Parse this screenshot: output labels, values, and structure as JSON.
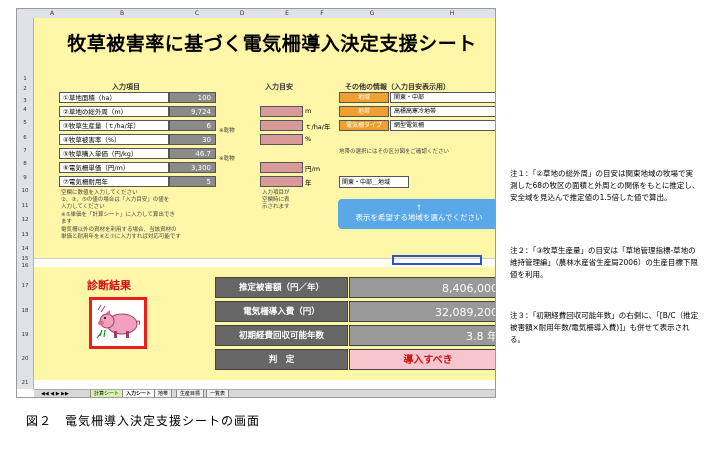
{
  "title": "牧草被害率に基づく電気柵導入決定支援シート",
  "col_headers": [
    "A",
    "B",
    "C",
    "D",
    "E",
    "F",
    "G",
    "H"
  ],
  "row_headers": [
    "1",
    "2",
    "3",
    "4",
    "5",
    "6",
    "7",
    "8",
    "9",
    "10",
    "11",
    "12",
    "13",
    "14",
    "15",
    "16",
    "17",
    "18",
    "19",
    "20",
    "21"
  ],
  "section_input": "入力項目",
  "section_guide": "入力目安",
  "section_other": "その他の情報（入力目安表示用）",
  "inputs": [
    {
      "label": "①草地面積（ha）",
      "value": "100"
    },
    {
      "label": "②草地の総外周（m）",
      "value": "9,724"
    },
    {
      "label": "③牧草生産量（ｔ/ha/年）",
      "value": "6"
    },
    {
      "label": "④牧草被害率（%）",
      "value": "30"
    },
    {
      "label": "⑤牧草購入単価（円/kg）",
      "value": "46.7"
    },
    {
      "label": "⑥電気柵単価（円/m）",
      "value": "3,300"
    },
    {
      "label": "⑦電気柵耐用年",
      "value": "5"
    }
  ],
  "dry_note_1": "※乾物",
  "dry_note_2": "※乾物",
  "units": [
    "m",
    "ｔ/ha/年",
    "%",
    "円/m",
    "年"
  ],
  "other": [
    {
      "label": "地域",
      "value": "関東・中部"
    },
    {
      "label": "地帯",
      "value": "高標高寒冷地帯"
    },
    {
      "label": "電気柵タイプ",
      "value": "網型電気柵"
    }
  ],
  "region_note": "地帯の選択にはその区分図をご確認ください",
  "region_value": "関東・中部＿地域",
  "left_notes": [
    "空欄に数値を入力してください",
    "②、③、⑤の値の場合は「入力目安」の値を",
    "入力してください",
    "※⑤単価を「計算シート」に入力して算出でき",
    "ます",
    "電気柵以外の資材を利用する場合、当該資材の",
    "単価と耐用年を⑥と⑦に入力すれば対応可能です"
  ],
  "guide_notes": [
    "入力項目が",
    "空欄時に表",
    "示されます"
  ],
  "button_arrow": "↑",
  "button_label": "表示を希望する地域を選んでください",
  "diag_title": "診断結果",
  "results": [
    {
      "label": "推定被害額（円／年）",
      "value": "8,406,000"
    },
    {
      "label": "電気柵導入費（円）",
      "value": "32,089,200"
    },
    {
      "label": "初期経費回収可能年数",
      "value": "3.8 年"
    },
    {
      "label": "判　定",
      "value": "導入すべき"
    }
  ],
  "tabs": [
    "計算シート",
    "入力シート",
    "地帯",
    "生産目標",
    "一覧表"
  ],
  "caption": "図２　電気柵導入決定支援シートの画面",
  "side_notes": [
    "注１：「②草地の総外周」の目安は関東地域の牧場で実測した68の牧区の面積と外周との関係をもとに推定し、安全域を見込んで推定値の1.5倍した値で算出。",
    "注２：「③牧草生産量」の目安は「草地管理指標-草地の維持管理編」（農林水産省生産局2006）の生産目標下限値を利用。",
    "注３：「初期経費回収可能年数」の右側に、「[B/C（推定被害額×耐用年数/電気柵導入費)]」も併せて表示される。"
  ],
  "colors": {
    "sheet_bg": "#fff6a8",
    "value_cell": "#8b8b8b",
    "input_cell": "#d99a9a",
    "orange": "#f0a030",
    "button": "#5aa8e8",
    "verdict_bg": "#f6c6cc",
    "verdict_text": "#d01010"
  }
}
